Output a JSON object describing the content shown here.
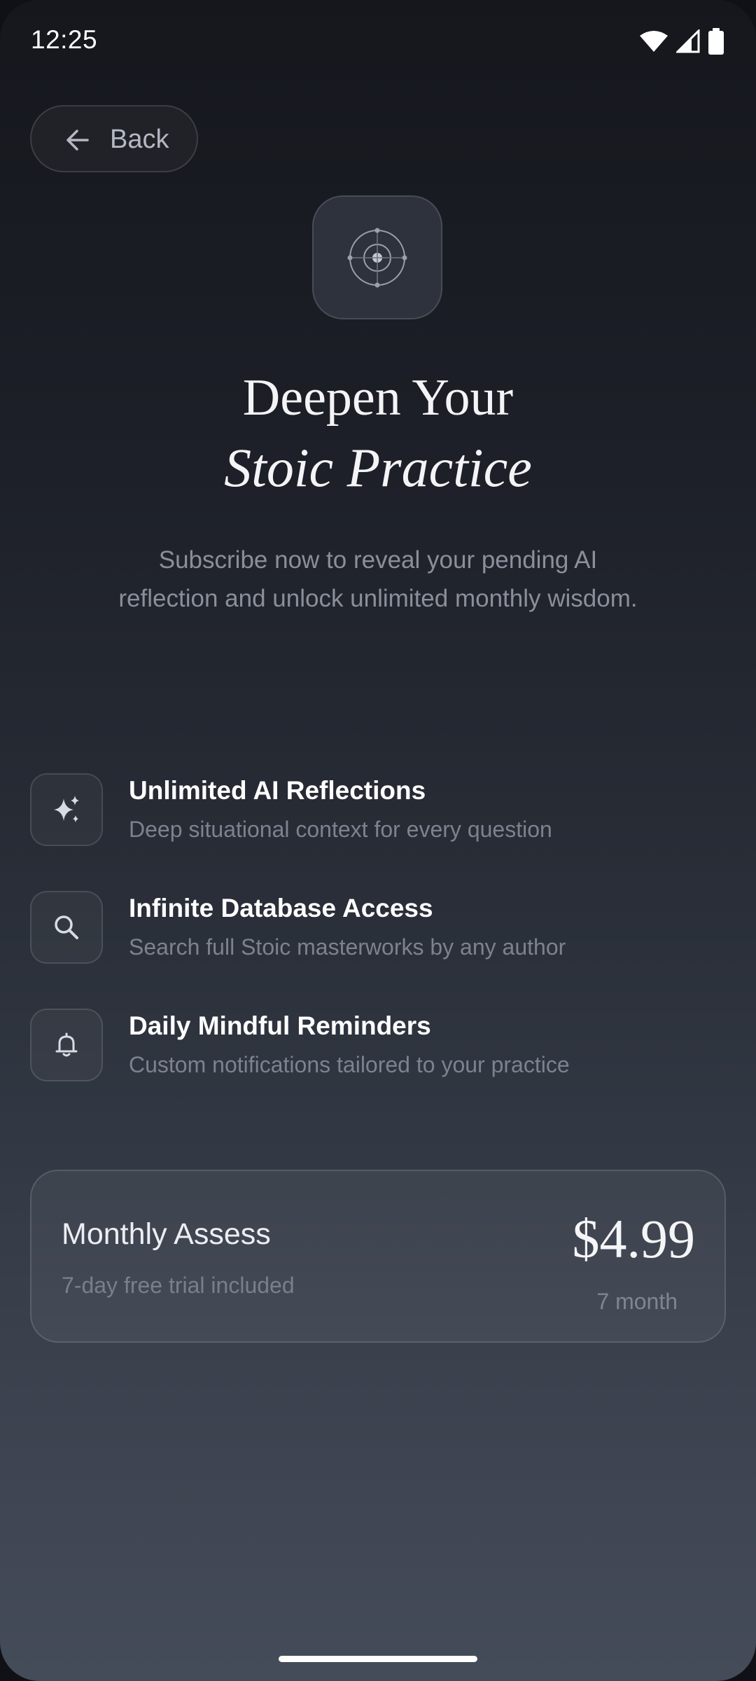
{
  "status_bar": {
    "time": "12:25",
    "icons": [
      "wifi-icon",
      "cellular-signal-icon",
      "battery-icon"
    ]
  },
  "back_button": {
    "label": "Back",
    "icon": "arrow-left-icon"
  },
  "hero": {
    "icon": "target-icon",
    "title_line1": "Deepen Your",
    "title_line2": "Stoic Practice",
    "subtitle": "Subscribe now to reveal your pending AI reflection and unlock unlimited monthly wisdom."
  },
  "features": [
    {
      "icon": "sparkles-icon",
      "title": "Unlimited AI Reflections",
      "description": "Deep situational context for every question"
    },
    {
      "icon": "search-icon",
      "title": "Infinite Database Access",
      "description": "Search full Stoic masterworks by any author"
    },
    {
      "icon": "bell-icon",
      "title": "Daily Mindful Reminders",
      "description": "Custom notifications tailored to your practice"
    }
  ],
  "plan": {
    "name": "Monthly Assess",
    "trial": "7-day free trial included",
    "price": "$4.99",
    "period": "7 month"
  },
  "colors": {
    "background_top": "#15171d",
    "background_bottom": "#454c59",
    "text_primary": "#ffffff",
    "text_muted": "#7d828e"
  }
}
